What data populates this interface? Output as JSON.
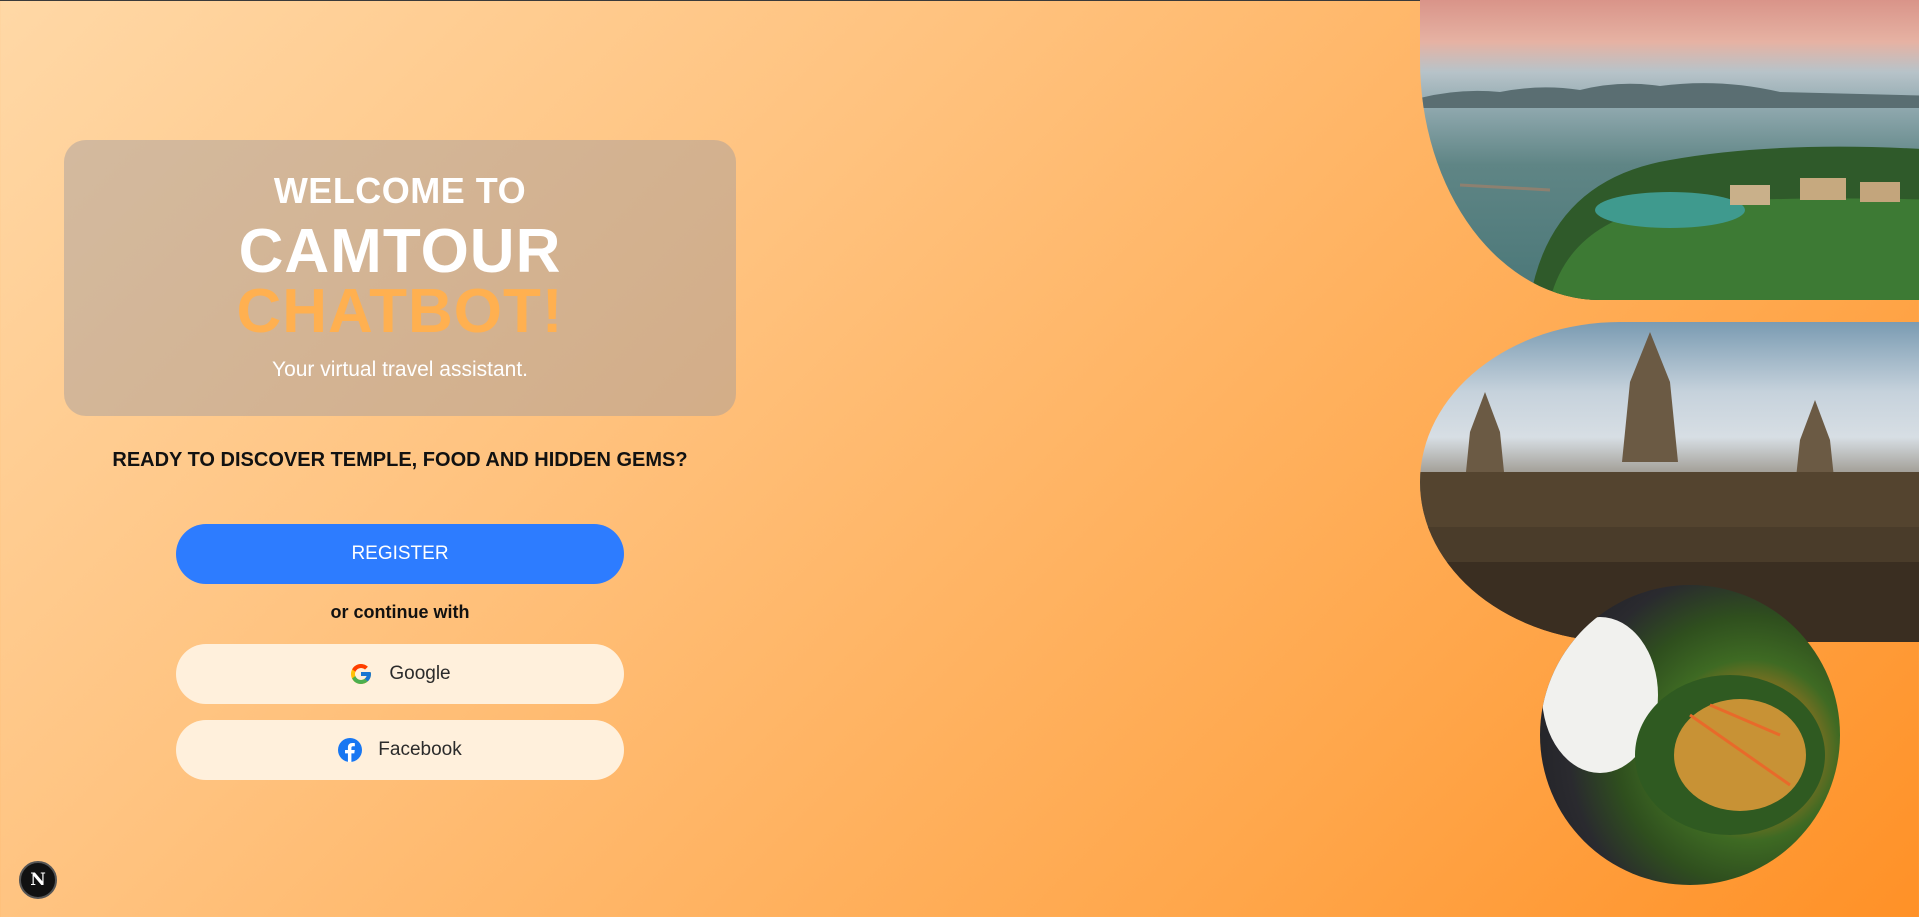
{
  "hero": {
    "welcome": "WELCOME TO",
    "brand": "CAMTOUR",
    "brand_accent": "CHATBOT!",
    "tagline": "Your virtual travel assistant."
  },
  "prompt": "READY TO DISCOVER TEMPLE, FOOD AND HIDDEN GEMS?",
  "register_label": "REGISTER",
  "or_text": "or continue with",
  "social": {
    "google_label": "Google",
    "facebook_label": "Facebook"
  },
  "icons": {
    "google": "google-icon",
    "facebook": "facebook-icon",
    "dev_badge": "next-logo"
  },
  "dev_badge_letter": "N",
  "colors": {
    "accent": "#ffb050",
    "primary_button": "#2d7cff",
    "social_button": "#fff0dc",
    "facebook_blue": "#1877f2"
  }
}
